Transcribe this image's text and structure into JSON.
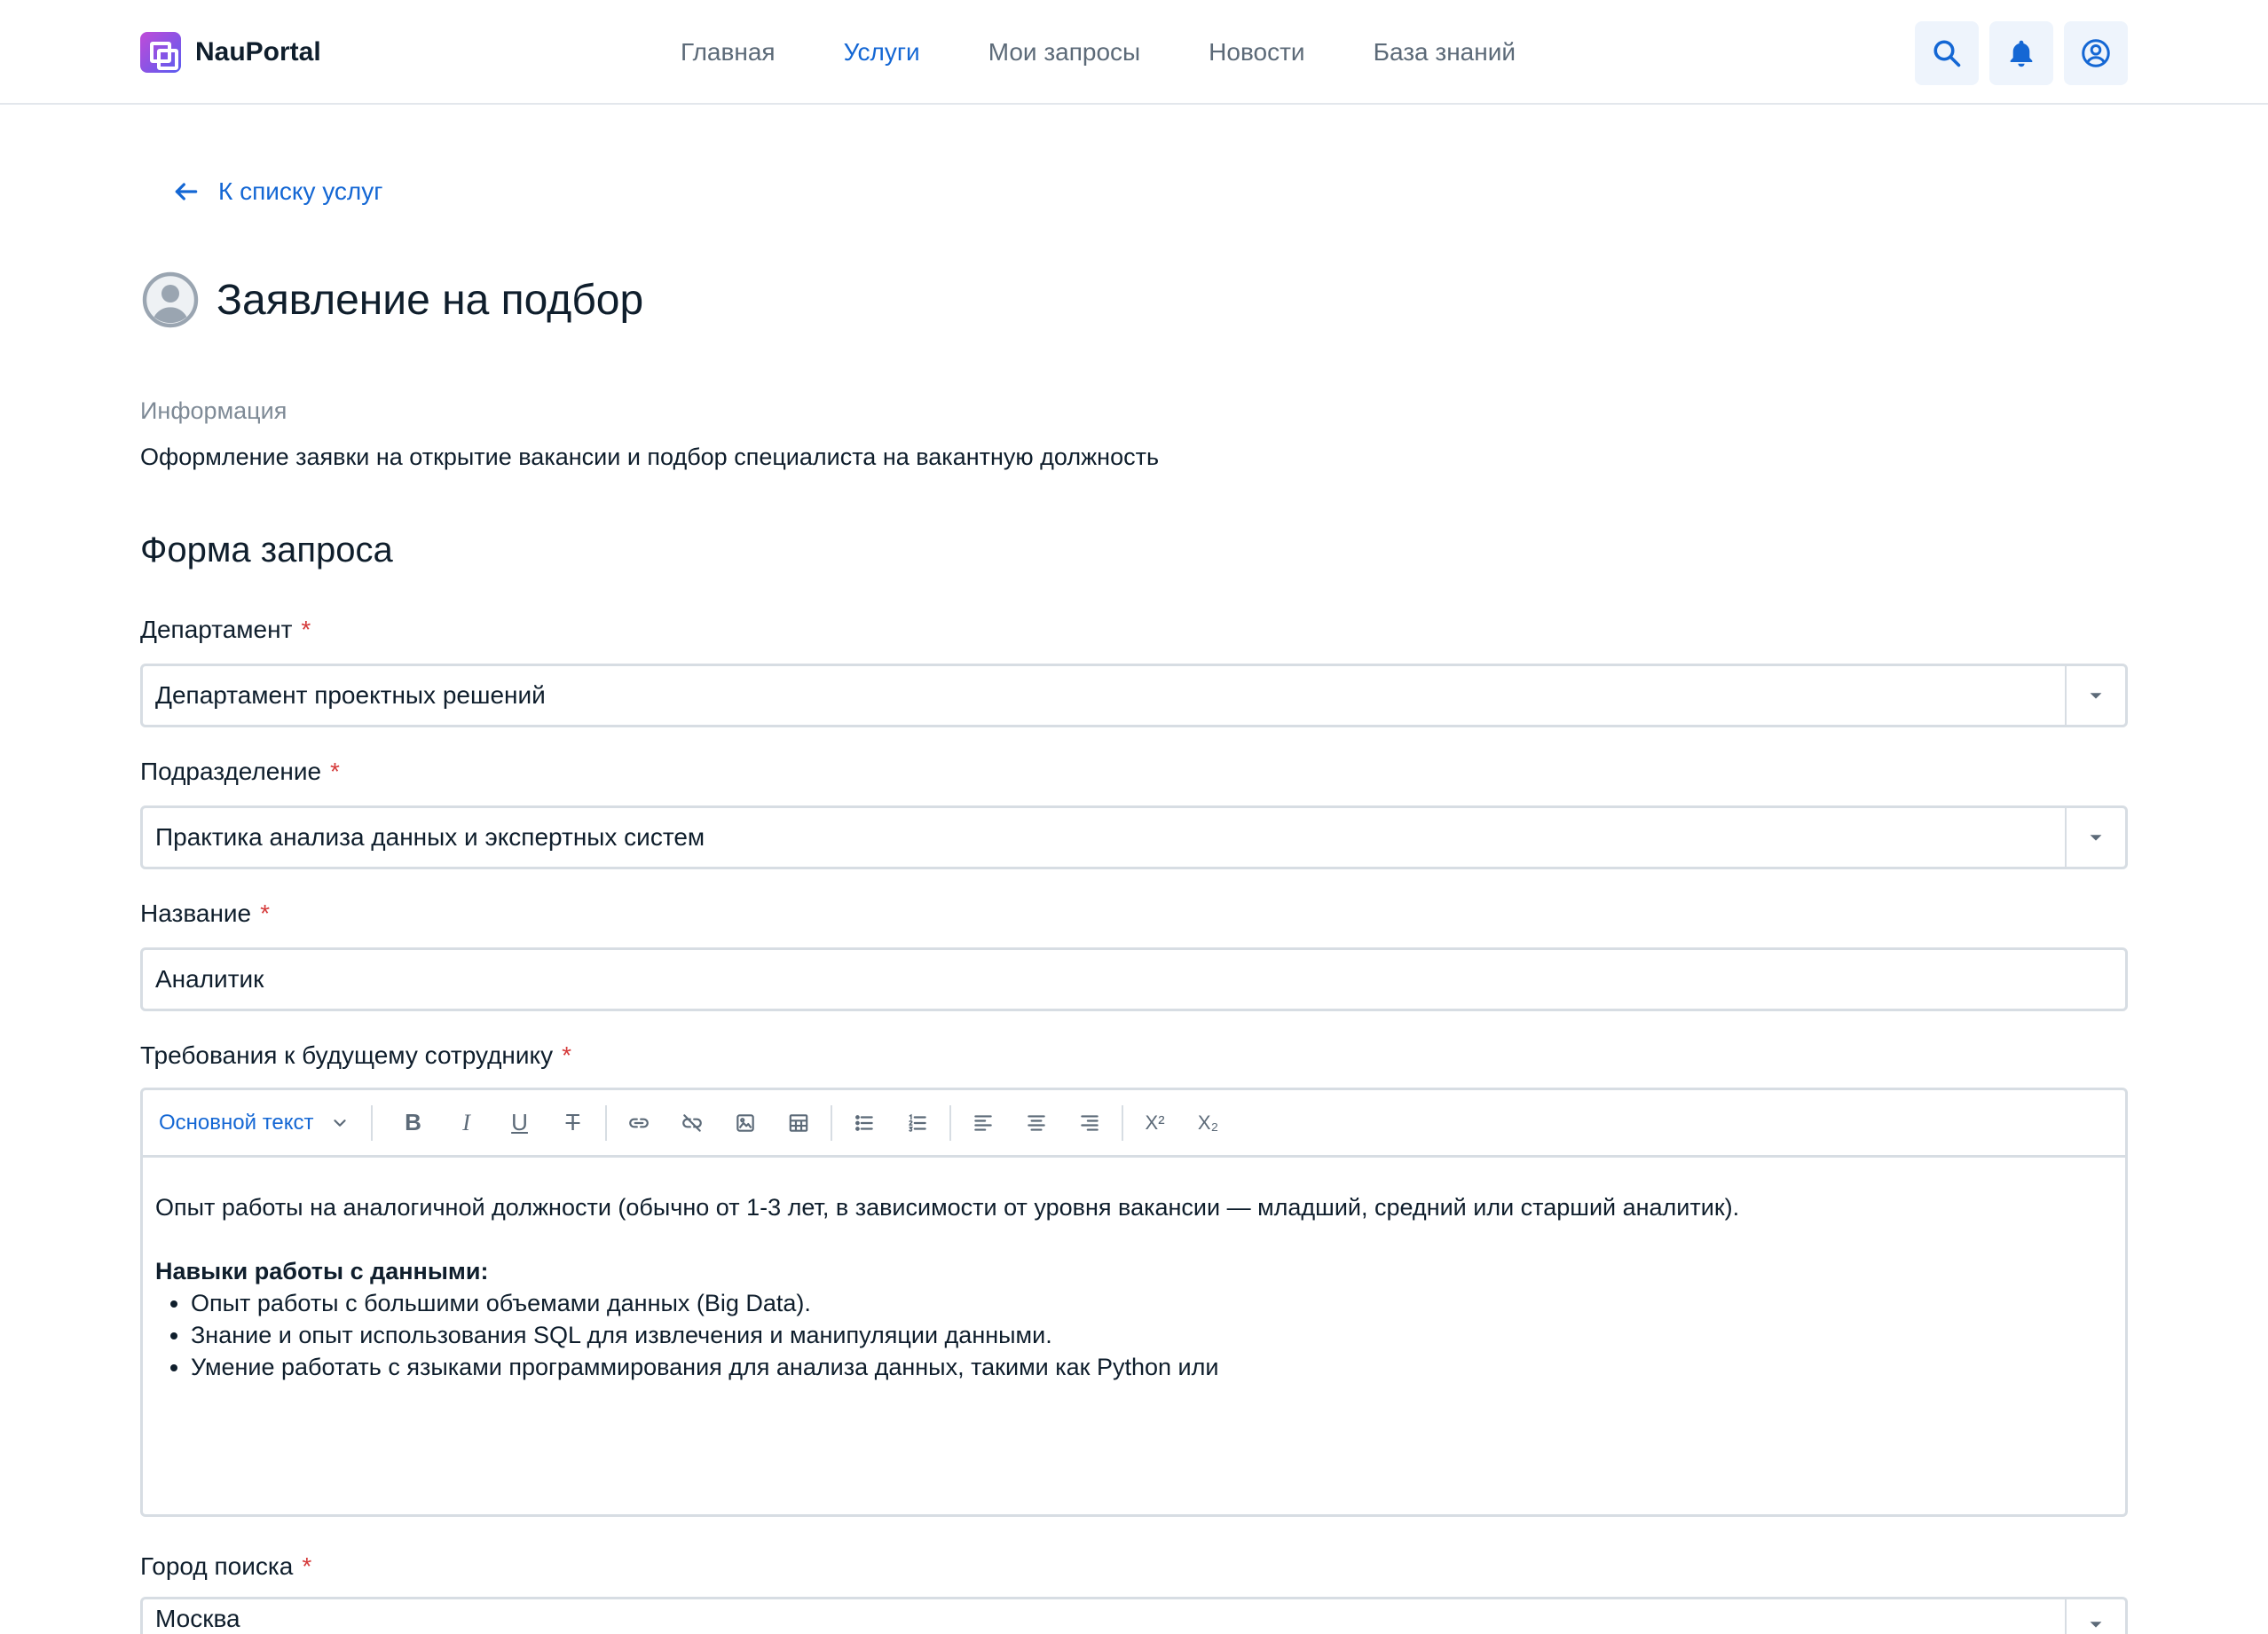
{
  "header": {
    "logo_text": "NauPortal",
    "nav": [
      {
        "label": "Главная",
        "active": false
      },
      {
        "label": "Услуги",
        "active": true
      },
      {
        "label": "Мои запросы",
        "active": false
      },
      {
        "label": "Новости",
        "active": false
      },
      {
        "label": "База знаний",
        "active": false
      }
    ],
    "actions": [
      "search-icon",
      "bell-icon",
      "user-circle-icon"
    ],
    "accent_color": "#1467d4"
  },
  "back_link": {
    "label": "К списку услуг"
  },
  "page": {
    "title": "Заявление на подбор",
    "info_label": "Информация",
    "info_text": "Оформление заявки на открытие вакансии и подбор специалиста на вакантную должность"
  },
  "form": {
    "title": "Форма запроса",
    "required_mark": "*",
    "department": {
      "label": "Департамент",
      "value": "Департамент проектных решений"
    },
    "division": {
      "label": "Подразделение",
      "value": "Практика анализа данных и экспертных систем"
    },
    "name": {
      "label": "Название",
      "value": "Аналитик"
    },
    "requirements": {
      "label": "Требования к будущему сотруднику",
      "style_label": "Основной текст",
      "toolbar": {
        "bold": "B",
        "italic": "I",
        "underline": "U",
        "strike": "T",
        "superscript": "X²",
        "subscript": "X₂"
      },
      "paragraph": "Опыт работы на аналогичной должности (обычно от 1-3 лет, в зависимости от уровня вакансии — младший, средний или старший аналитик).",
      "heading": "Навыки работы с данными:",
      "bullets": [
        "Опыт работы с большими объемами данных (Big Data).",
        "Знание и опыт использования SQL для извлечения и манипуляции данными.",
        "Умение работать с языками программирования для анализа данных, такими как Python или"
      ]
    },
    "city": {
      "label": "Город поиска",
      "value": "Москва"
    }
  }
}
